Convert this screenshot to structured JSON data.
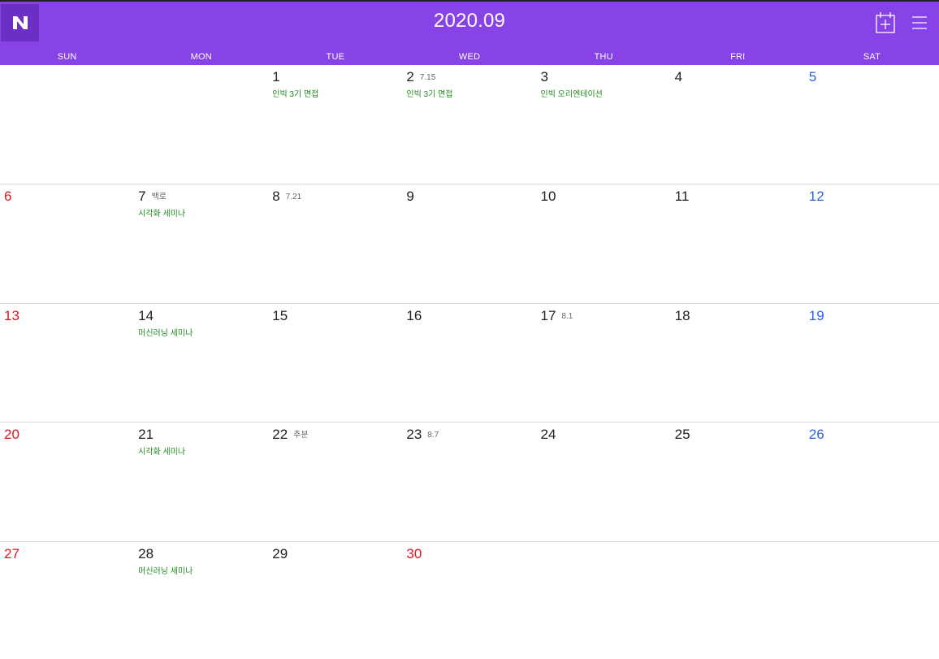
{
  "header": {
    "title": "2020.09",
    "logo_letter": "N",
    "colors": {
      "bar": "#8743e6",
      "logo_bg": "#6c2fc4",
      "sunday": "#e8131f",
      "saturday": "#2b63e0",
      "event": "#1f8a1f"
    },
    "add_icon": "calendar-plus-icon",
    "menu_icon": "hamburger-menu-icon"
  },
  "weekdays": [
    "SUN",
    "MON",
    "TUE",
    "WED",
    "THU",
    "FRI",
    "SAT"
  ],
  "weeks": [
    [
      {
        "day": "",
        "note": "",
        "event": ""
      },
      {
        "day": "",
        "note": "",
        "event": ""
      },
      {
        "day": "1",
        "note": "",
        "event": "인빅 3기 면접"
      },
      {
        "day": "2",
        "note": "7.15",
        "event": "인빅 3기 면접"
      },
      {
        "day": "3",
        "note": "",
        "event": "인빅 오리엔테이션"
      },
      {
        "day": "4",
        "note": "",
        "event": ""
      },
      {
        "day": "5",
        "note": "",
        "event": ""
      }
    ],
    [
      {
        "day": "6",
        "note": "",
        "event": ""
      },
      {
        "day": "7",
        "note": "백로",
        "event": "시각화 세미나"
      },
      {
        "day": "8",
        "note": "7.21",
        "event": ""
      },
      {
        "day": "9",
        "note": "",
        "event": ""
      },
      {
        "day": "10",
        "note": "",
        "event": ""
      },
      {
        "day": "11",
        "note": "",
        "event": ""
      },
      {
        "day": "12",
        "note": "",
        "event": ""
      }
    ],
    [
      {
        "day": "13",
        "note": "",
        "event": ""
      },
      {
        "day": "14",
        "note": "",
        "event": "머신러닝 세미나"
      },
      {
        "day": "15",
        "note": "",
        "event": ""
      },
      {
        "day": "16",
        "note": "",
        "event": ""
      },
      {
        "day": "17",
        "note": "8.1",
        "event": ""
      },
      {
        "day": "18",
        "note": "",
        "event": ""
      },
      {
        "day": "19",
        "note": "",
        "event": ""
      }
    ],
    [
      {
        "day": "20",
        "note": "",
        "event": ""
      },
      {
        "day": "21",
        "note": "",
        "event": "시각화 세미나"
      },
      {
        "day": "22",
        "note": "추분",
        "event": ""
      },
      {
        "day": "23",
        "note": "8.7",
        "event": ""
      },
      {
        "day": "24",
        "note": "",
        "event": ""
      },
      {
        "day": "25",
        "note": "",
        "event": ""
      },
      {
        "day": "26",
        "note": "",
        "event": ""
      }
    ],
    [
      {
        "day": "27",
        "note": "",
        "event": ""
      },
      {
        "day": "28",
        "note": "",
        "event": "머신러닝 세미나"
      },
      {
        "day": "29",
        "note": "",
        "event": ""
      },
      {
        "day": "30",
        "note": "",
        "event": "",
        "holiday": true
      },
      {
        "day": "",
        "note": "",
        "event": ""
      },
      {
        "day": "",
        "note": "",
        "event": ""
      },
      {
        "day": "",
        "note": "",
        "event": ""
      }
    ]
  ]
}
